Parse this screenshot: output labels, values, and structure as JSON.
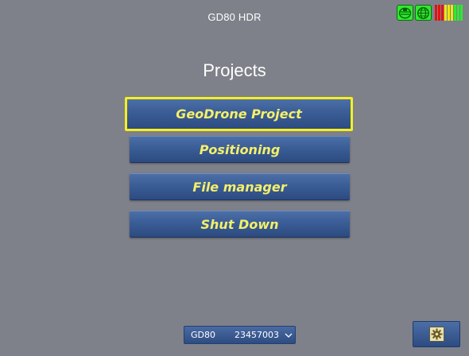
{
  "header": {
    "title": "GD80 HDR",
    "status_icons": [
      {
        "name": "antenna-signal-icon",
        "color": "#2eea2e"
      },
      {
        "name": "gps-globe-icon",
        "color": "#2eea2e"
      }
    ],
    "level_meter": {
      "colors": [
        "#e81010",
        "#e81010",
        "#e81010",
        "#f0e60a",
        "#f0e60a",
        "#f0e60a",
        "#2eea2e",
        "#2eea2e",
        "#2eea2e"
      ]
    }
  },
  "page": {
    "title": "Projects"
  },
  "menu": {
    "items": [
      {
        "label": "GeoDrone Project",
        "selected": true
      },
      {
        "label": "Positioning",
        "selected": false
      },
      {
        "label": "File manager",
        "selected": false
      },
      {
        "label": "Shut Down",
        "selected": false
      }
    ]
  },
  "footer": {
    "device_select": {
      "model": "GD80",
      "serial": "23457003",
      "chevron_icon": "chevron-down-icon"
    },
    "settings_button": {
      "icon": "gear-icon"
    }
  },
  "colors": {
    "background": "#7e8189",
    "button": "#3b5d96",
    "button_text": "#f4ef6a",
    "selection_border": "#f6ef1f"
  }
}
